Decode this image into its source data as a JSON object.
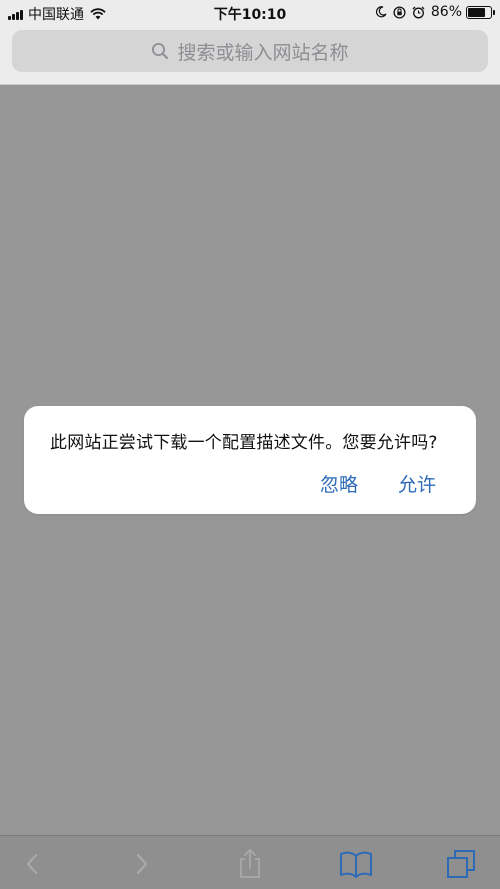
{
  "status_bar": {
    "carrier": "中国联通",
    "time": "下午10:10",
    "battery_percent": "86%",
    "battery_level": 0.86,
    "icons": [
      "signal-icon",
      "wifi-icon",
      "moon-icon",
      "rotation-lock-icon",
      "alarm-icon",
      "battery-icon"
    ]
  },
  "address_bar": {
    "placeholder": "搜索或输入网站名称",
    "icon": "search-icon"
  },
  "alert": {
    "message": "此网站正尝试下载一个配置描述文件。您要允许吗?",
    "ignore_label": "忽略",
    "allow_label": "允许",
    "button_color": "#2e6bb7"
  },
  "toolbar": {
    "icons": [
      "back-icon",
      "forward-icon",
      "share-icon",
      "bookmarks-icon",
      "tabs-icon"
    ]
  },
  "colors": {
    "dim_overlay": "#979797",
    "accent": "#2e6bb7"
  }
}
